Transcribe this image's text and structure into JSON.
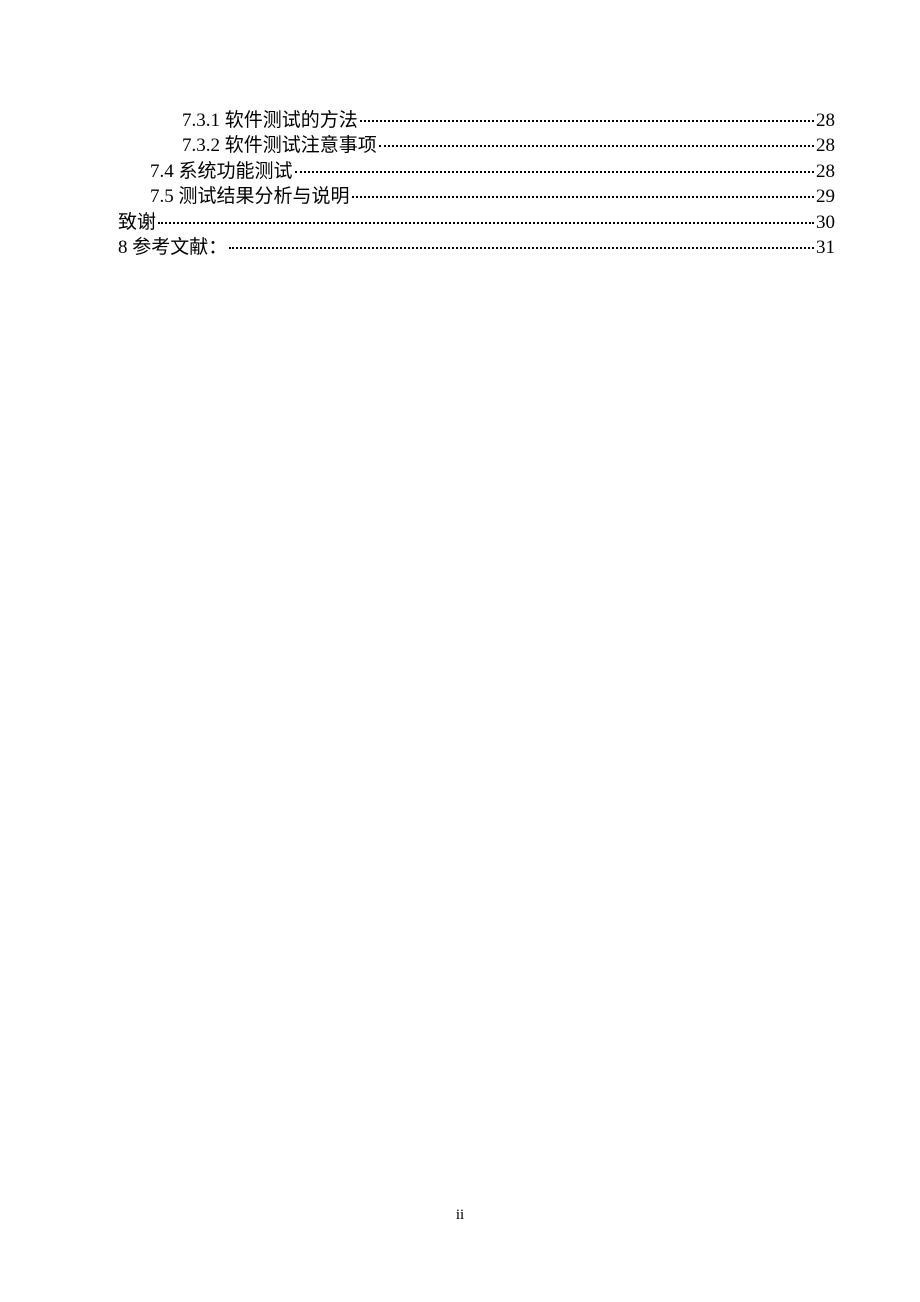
{
  "toc": {
    "entries": [
      {
        "indent": 2,
        "title": "7.3.1 软件测试的方法",
        "page": "28"
      },
      {
        "indent": 2,
        "title": "7.3.2 软件测试注意事项",
        "page": "28"
      },
      {
        "indent": 1,
        "title": "7.4 系统功能测试",
        "page": "28"
      },
      {
        "indent": 1,
        "title": "7.5 测试结果分析与说明",
        "page": "29"
      },
      {
        "indent": 0,
        "title": "致谢",
        "page": "30"
      },
      {
        "indent": 0,
        "title": "8  参考文献：",
        "page": "31"
      }
    ]
  },
  "footer": {
    "page_label": "ii"
  }
}
